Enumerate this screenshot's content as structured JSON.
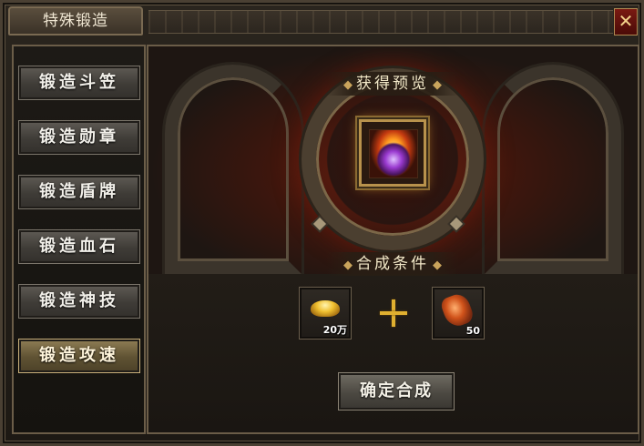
{
  "window": {
    "title": "特殊锻造",
    "close_glyph": "✕"
  },
  "menu": [
    {
      "label": "锻造斗笠",
      "active": false
    },
    {
      "label": "锻造勋章",
      "active": false
    },
    {
      "label": "锻造盾牌",
      "active": false
    },
    {
      "label": "锻造血石",
      "active": false
    },
    {
      "label": "锻造神技",
      "active": false
    },
    {
      "label": "锻造攻速",
      "active": true
    }
  ],
  "preview": {
    "title": "获得预览",
    "item_icon": "flame-orb-icon"
  },
  "conditions": {
    "title": "合成条件",
    "materials": [
      {
        "icon": "gold-ingot-icon",
        "quantity": "20万"
      },
      {
        "icon": "fire-stone-icon",
        "quantity": "50"
      }
    ]
  },
  "confirm_label": "确定合成",
  "colors": {
    "accent_gold": "#c9a45c",
    "active_tab": "#8b7a52",
    "close_red": "#7a1a12"
  }
}
